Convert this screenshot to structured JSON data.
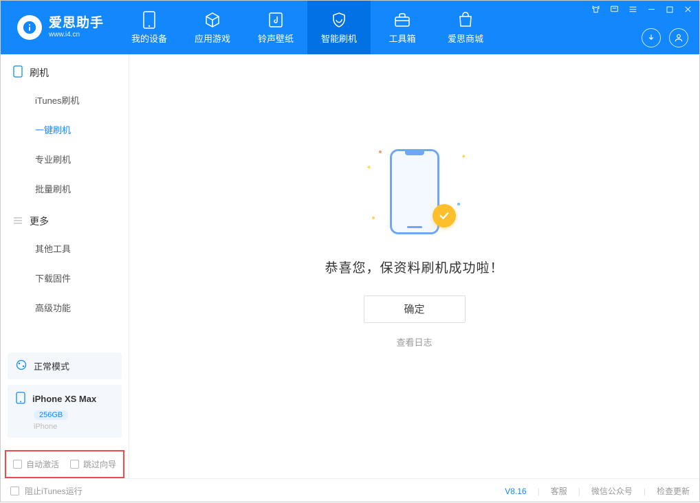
{
  "app": {
    "title": "爱思助手",
    "subtitle": "www.i4.cn"
  },
  "nav": {
    "items": [
      {
        "label": "我的设备"
      },
      {
        "label": "应用游戏"
      },
      {
        "label": "铃声壁纸"
      },
      {
        "label": "智能刷机"
      },
      {
        "label": "工具箱"
      },
      {
        "label": "爱思商城"
      }
    ]
  },
  "sidebar": {
    "groups": [
      {
        "title": "刷机",
        "items": [
          "iTunes刷机",
          "一键刷机",
          "专业刷机",
          "批量刷机"
        ]
      },
      {
        "title": "更多",
        "items": [
          "其他工具",
          "下载固件",
          "高级功能"
        ]
      }
    ],
    "mode": "正常模式",
    "device": {
      "name": "iPhone XS Max",
      "storage": "256GB",
      "type": "iPhone"
    },
    "checkboxes": {
      "auto_activate": "自动激活",
      "skip_guide": "跳过向导"
    }
  },
  "main": {
    "success_text": "恭喜您，保资料刷机成功啦！",
    "ok_button": "确定",
    "log_link": "查看日志"
  },
  "footer": {
    "block_itunes": "阻止iTunes运行",
    "version": "V8.16",
    "links": [
      "客服",
      "微信公众号",
      "检查更新"
    ]
  }
}
